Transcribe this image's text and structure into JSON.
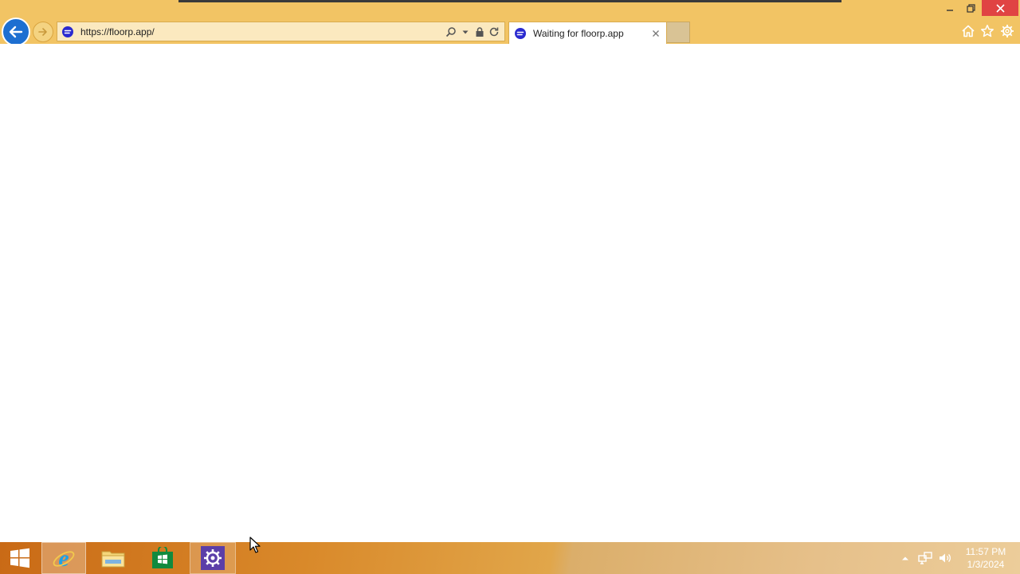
{
  "browser": {
    "address_url": "https://floorp.app/",
    "tabs": [
      {
        "label": "Waiting for floorp.app",
        "active": true
      }
    ],
    "accent_color": "#f2c464",
    "icons": {
      "back": "arrow-left-icon",
      "forward": "arrow-right-icon",
      "site": "floorp-logo-icon",
      "search": "search-icon",
      "dropdown": "chevron-down-icon",
      "lock": "lock-icon",
      "refresh": "refresh-icon",
      "close_tab": "close-icon",
      "home": "home-icon",
      "favorites": "star-icon",
      "tools": "gear-icon"
    }
  },
  "taskbar": {
    "apps": [
      {
        "name": "Internet Explorer",
        "icon": "ie-icon",
        "active": true
      },
      {
        "name": "File Explorer",
        "icon": "folder-icon",
        "active": false
      },
      {
        "name": "Store",
        "icon": "store-icon",
        "active": false
      },
      {
        "name": "Settings",
        "icon": "gear-icon",
        "active": true
      }
    ],
    "clock": {
      "time": "11:57 PM",
      "date": "1/3/2024"
    }
  }
}
